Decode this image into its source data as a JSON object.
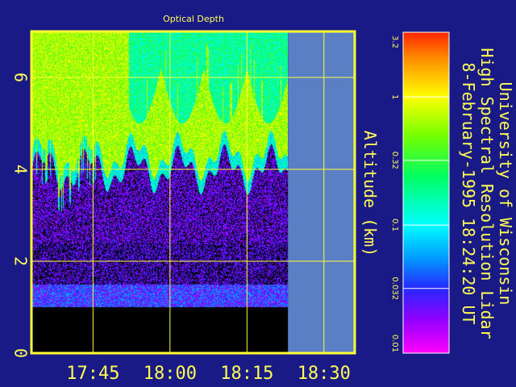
{
  "chart_data": {
    "type": "heatmap",
    "title": "Optical Depth",
    "ylabel": "Altitude (km)",
    "xlabel": "",
    "x_ticks": [
      "17:45",
      "18:00",
      "18:15",
      "18:30"
    ],
    "x_tick_values_min": [
      1065,
      1080,
      1095,
      1110
    ],
    "xlim_min": [
      1053,
      1116
    ],
    "y_ticks": [
      "0",
      "2",
      "4",
      "6"
    ],
    "y_tick_values": [
      0,
      2,
      4,
      6
    ],
    "ylim": [
      0,
      7
    ],
    "data_end_time_min": 1103,
    "grid": true,
    "colorbar": {
      "scale": "log",
      "range": [
        0.01,
        3.2
      ],
      "ticks": [
        "3.2",
        "1",
        "0.32",
        "0.1",
        "0.032",
        "0.01"
      ],
      "tick_values": [
        3.2,
        1,
        0.32,
        0.1,
        0.032,
        0.01
      ]
    },
    "profile_model": {
      "ground_blocked_top_km": 1.0,
      "boundary_layer_top_km": 2.4,
      "cloud_base_km": 4.0
    }
  },
  "header": {
    "line1": "University of Wisconsin",
    "line2": "High Spectral Resolution Lidar",
    "line3": "8-February-1995 18:24:20 UT"
  },
  "colors": {
    "background": "#1a1a86",
    "frame": "#ffff33",
    "no_data": "#5a7fc5",
    "text": "#ffff55"
  }
}
